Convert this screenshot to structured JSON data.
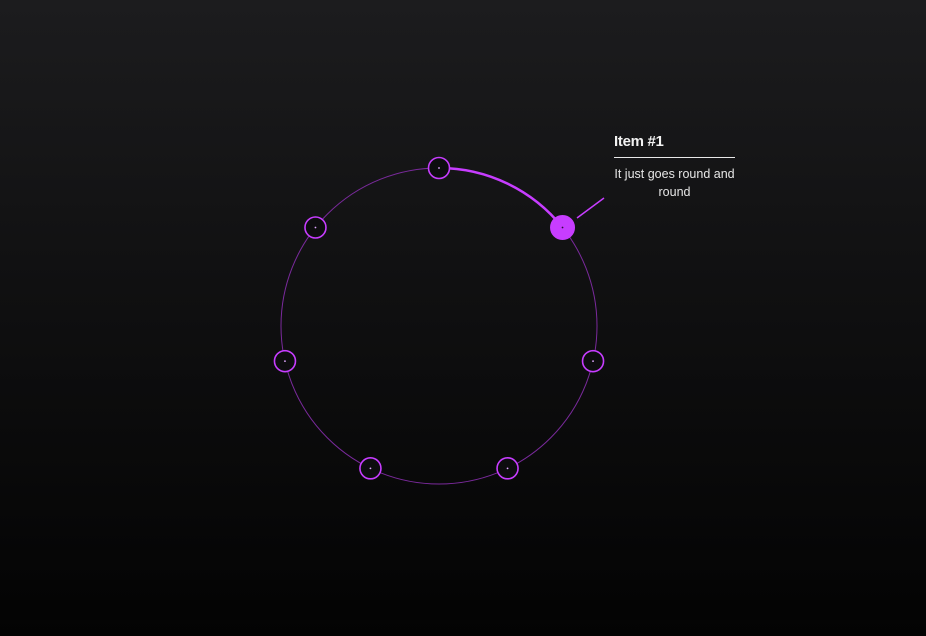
{
  "colors": {
    "accent": "#c73dff",
    "ring": "#7a2a9c",
    "node_fill": "#0d0d0f",
    "text": "#f2f2f2"
  },
  "carousel": {
    "item_count": 7,
    "active_index": 1
  },
  "tooltip": {
    "title": "Item #1",
    "body": "It just goes round and round"
  }
}
